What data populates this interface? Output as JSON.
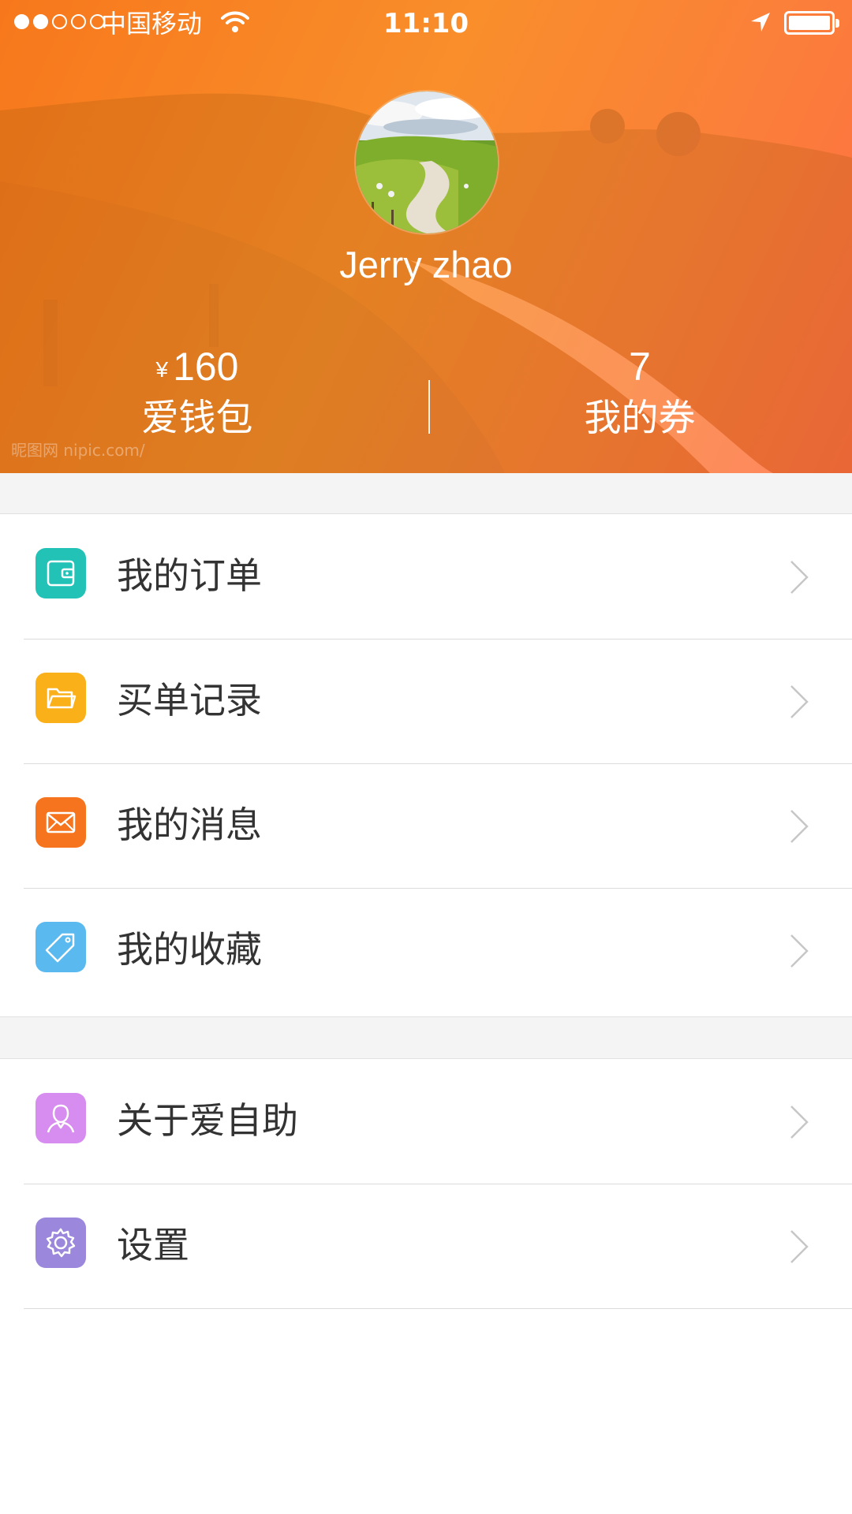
{
  "status_bar": {
    "signal_bars": 5,
    "signal_filled": 2,
    "carrier": "中国移动",
    "time": "11:10",
    "battery_level": 1.0
  },
  "profile": {
    "user_name": "Jerry zhao",
    "wallet": {
      "currency": "¥",
      "amount": "160",
      "label": "爱钱包"
    },
    "coupons": {
      "count": "7",
      "label": "我的券"
    },
    "watermark": "昵图网 nipic.com/"
  },
  "menu_primary": [
    {
      "label": "我的订单",
      "icon": "wallet-icon",
      "color": "#22c2b7"
    },
    {
      "label": "买单记录",
      "icon": "folder-icon",
      "color": "#fab019"
    },
    {
      "label": "我的消息",
      "icon": "envelope-icon",
      "color": "#f7741f"
    },
    {
      "label": "我的收藏",
      "icon": "tag-icon",
      "color": "#5ab9ee"
    }
  ],
  "menu_secondary": [
    {
      "label": "关于爱自助",
      "icon": "person-icon",
      "color": "#d78cf0"
    },
    {
      "label": "设置",
      "icon": "gear-icon",
      "color": "#9b87db"
    }
  ],
  "colors": {
    "header_gradient_start": "#f7781c",
    "header_gradient_end": "#ff6d43",
    "list_text": "#333333",
    "separator": "#dcdcdc",
    "section_gap": "#f4f4f4",
    "chevron": "#c7c7c7"
  }
}
